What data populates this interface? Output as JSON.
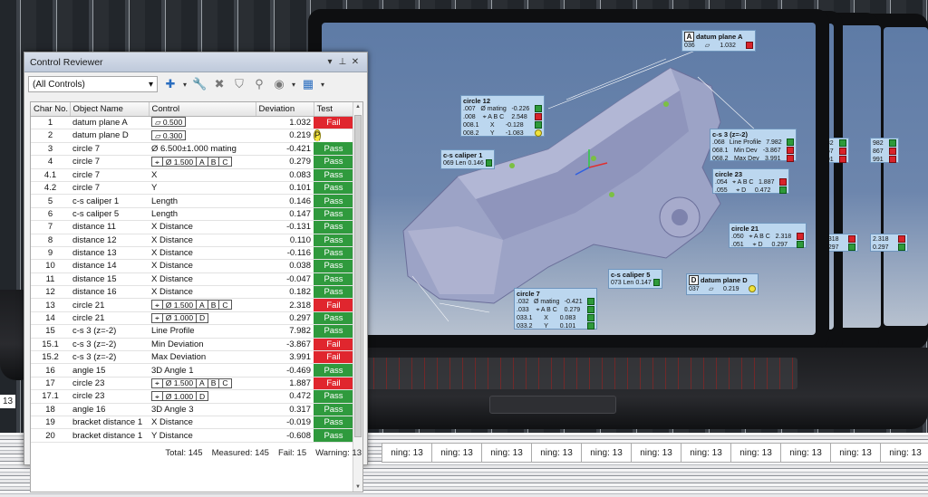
{
  "background": {
    "side_caption": "13",
    "bottom_captions": [
      "ning: 13",
      "ning: 13",
      "ning: 13",
      "ning: 13",
      "ning: 13",
      "ning: 13",
      "ning: 13",
      "ning: 13",
      "ning: 13",
      "ning: 13",
      "ning: 13"
    ]
  },
  "callouts": {
    "datum_a": {
      "letter": "A",
      "title": "datum plane A",
      "rows": [
        {
          "id": "036",
          "val": "1.032",
          "status": "fail"
        }
      ]
    },
    "circle12": {
      "title": "circle 12",
      "rows": [
        {
          "id": ".007",
          "c": "Ø  mating",
          "val": "-0.226",
          "status": "ok"
        },
        {
          "id": ".008",
          "c": "⌖ A B C",
          "val": "2.548",
          "status": "fail"
        },
        {
          "id": "008.1",
          "c": "X",
          "val": "-0.128",
          "status": "ok"
        },
        {
          "id": "008.2",
          "c": "Y",
          "val": "-1.083",
          "status": "warn"
        }
      ]
    },
    "cs_caliper1": {
      "title": "c-s caliper 1",
      "rows": [
        {
          "id": "069 Len",
          "val": "0.146",
          "status": "ok"
        }
      ]
    },
    "cs3": {
      "title": "c-s 3 (z=-2)",
      "rows": [
        {
          "id": ".068",
          "c": "Line Profile",
          "val": "7.982",
          "status": "ok"
        },
        {
          "id": "068.1",
          "c": "Min Dev",
          "val": "-3.867",
          "status": "fail"
        },
        {
          "id": "068.2",
          "c": "Max Dev",
          "val": "3.991",
          "status": "fail"
        }
      ]
    },
    "circle23": {
      "title": "circle 23",
      "rows": [
        {
          "id": ".054",
          "c": "⌖ A B C",
          "val": "1.887",
          "status": "fail"
        },
        {
          "id": ".055",
          "c": "⌖ D",
          "val": "0.472",
          "status": "ok"
        }
      ]
    },
    "circle21": {
      "title": "circle 21",
      "rows": [
        {
          "id": ".050",
          "c": "⌖ A B C",
          "val": "2.318",
          "status": "fail"
        },
        {
          "id": ".051",
          "c": "⌖ D",
          "val": "0.297",
          "status": "ok"
        }
      ]
    },
    "cs_caliper5": {
      "title": "c-s caliper 5",
      "rows": [
        {
          "id": "073 Len",
          "val": "0.147",
          "status": "ok"
        }
      ]
    },
    "circle7": {
      "title": "circle 7",
      "rows": [
        {
          "id": ".032",
          "c": "Ø  mating",
          "val": "-0.421",
          "status": "ok"
        },
        {
          "id": ".033",
          "c": "⌖ A B C",
          "val": "0.279",
          "status": "ok"
        },
        {
          "id": "033.1",
          "c": "X",
          "val": "0.083",
          "status": "ok"
        },
        {
          "id": "033.2",
          "c": "Y",
          "val": "0.101",
          "status": "ok"
        }
      ]
    },
    "datum_d": {
      "letter": "D",
      "title": "datum plane D",
      "rows": [
        {
          "id": "037",
          "val": "0.219",
          "status": "warn"
        }
      ]
    },
    "right_rows": [
      {
        "a": "2.318",
        "b": "0.297"
      },
      {
        "a": "2.318",
        "b": "0.297"
      }
    ]
  },
  "panel": {
    "title": "Control Reviewer",
    "filter_value": "(All Controls)",
    "columns": [
      "Char No.",
      "Object Name",
      "Control",
      "Deviation",
      "Test"
    ],
    "rows": [
      {
        "no": "1",
        "name": "datum plane A",
        "ctrl": "▱ 0.500",
        "ctrl_type": "frame",
        "dev": "1.032",
        "test": "Fail"
      },
      {
        "no": "2",
        "name": "datum plane D",
        "ctrl": "▱ 0.300",
        "ctrl_type": "frame",
        "dev": "0.219",
        "test": "Pass",
        "warn": true
      },
      {
        "no": "3",
        "name": "circle 7",
        "ctrl": "Ø  6.500±1.000   mating",
        "ctrl_type": "text",
        "dev": "-0.421",
        "test": "Pass"
      },
      {
        "no": "4",
        "name": "circle 7",
        "ctrl": "⌖|Ø 1.500|A|B|C",
        "ctrl_type": "frame",
        "dev": "0.279",
        "test": "Pass"
      },
      {
        "no": "4.1",
        "name": "circle 7",
        "ctrl": "X",
        "ctrl_type": "text",
        "dev": "0.083",
        "test": "Pass"
      },
      {
        "no": "4.2",
        "name": "circle 7",
        "ctrl": "Y",
        "ctrl_type": "text",
        "dev": "0.101",
        "test": "Pass"
      },
      {
        "no": "5",
        "name": "c-s caliper 1",
        "ctrl": "Length",
        "ctrl_type": "text",
        "dev": "0.146",
        "test": "Pass"
      },
      {
        "no": "6",
        "name": "c-s caliper 5",
        "ctrl": "Length",
        "ctrl_type": "text",
        "dev": "0.147",
        "test": "Pass"
      },
      {
        "no": "7",
        "name": "distance 11",
        "ctrl": "X Distance",
        "ctrl_type": "text",
        "dev": "-0.131",
        "test": "Pass"
      },
      {
        "no": "8",
        "name": "distance 12",
        "ctrl": "X Distance",
        "ctrl_type": "text",
        "dev": "0.110",
        "test": "Pass"
      },
      {
        "no": "9",
        "name": "distance 13",
        "ctrl": "X Distance",
        "ctrl_type": "text",
        "dev": "-0.116",
        "test": "Pass"
      },
      {
        "no": "10",
        "name": "distance 14",
        "ctrl": "X Distance",
        "ctrl_type": "text",
        "dev": "0.038",
        "test": "Pass"
      },
      {
        "no": "11",
        "name": "distance 15",
        "ctrl": "X Distance",
        "ctrl_type": "text",
        "dev": "-0.047",
        "test": "Pass"
      },
      {
        "no": "12",
        "name": "distance 16",
        "ctrl": "X Distance",
        "ctrl_type": "text",
        "dev": "0.182",
        "test": "Pass"
      },
      {
        "no": "13",
        "name": "circle 21",
        "ctrl": "⌖|Ø 1.500|A|B|C",
        "ctrl_type": "frame",
        "dev": "2.318",
        "test": "Fail"
      },
      {
        "no": "14",
        "name": "circle 21",
        "ctrl": "⌖|Ø 1.000|D",
        "ctrl_type": "frame",
        "dev": "0.297",
        "test": "Pass"
      },
      {
        "no": "15",
        "name": "c-s 3 (z=-2)",
        "ctrl": "Line Profile",
        "ctrl_type": "text",
        "dev": "7.982",
        "test": "Pass"
      },
      {
        "no": "15.1",
        "name": "c-s 3 (z=-2)",
        "ctrl": "Min Deviation",
        "ctrl_type": "text",
        "dev": "-3.867",
        "test": "Fail"
      },
      {
        "no": "15.2",
        "name": "c-s 3 (z=-2)",
        "ctrl": "Max Deviation",
        "ctrl_type": "text",
        "dev": "3.991",
        "test": "Fail"
      },
      {
        "no": "16",
        "name": "angle 15",
        "ctrl": "3D Angle 1",
        "ctrl_type": "text",
        "dev": "-0.469",
        "test": "Pass"
      },
      {
        "no": "17",
        "name": "circle 23",
        "ctrl": "⌖|Ø 1.500|A|B|C",
        "ctrl_type": "frame",
        "dev": "1.887",
        "test": "Fail"
      },
      {
        "no": "17.1",
        "name": "circle 23",
        "ctrl": "⌖|Ø 1.000|D",
        "ctrl_type": "frame",
        "dev": "0.472",
        "test": "Pass"
      },
      {
        "no": "18",
        "name": "angle 16",
        "ctrl": "3D Angle 3",
        "ctrl_type": "text",
        "dev": "0.317",
        "test": "Pass"
      },
      {
        "no": "19",
        "name": "bracket distance 1",
        "ctrl": "X Distance",
        "ctrl_type": "text",
        "dev": "-0.019",
        "test": "Pass"
      },
      {
        "no": "20",
        "name": "bracket distance 1",
        "ctrl": "Y Distance",
        "ctrl_type": "text",
        "dev": "-0.608",
        "test": "Pass"
      }
    ],
    "status": {
      "total": "Total: 145",
      "measured": "Measured: 145",
      "fail": "Fail: 15",
      "warning": "Warning: 13"
    }
  },
  "colors": {
    "pass": "#2f9a3d",
    "fail": "#e0262e",
    "warn": "#f5e53a",
    "callout_bg": "#bcd7ef",
    "screen": "#6d86ad"
  }
}
